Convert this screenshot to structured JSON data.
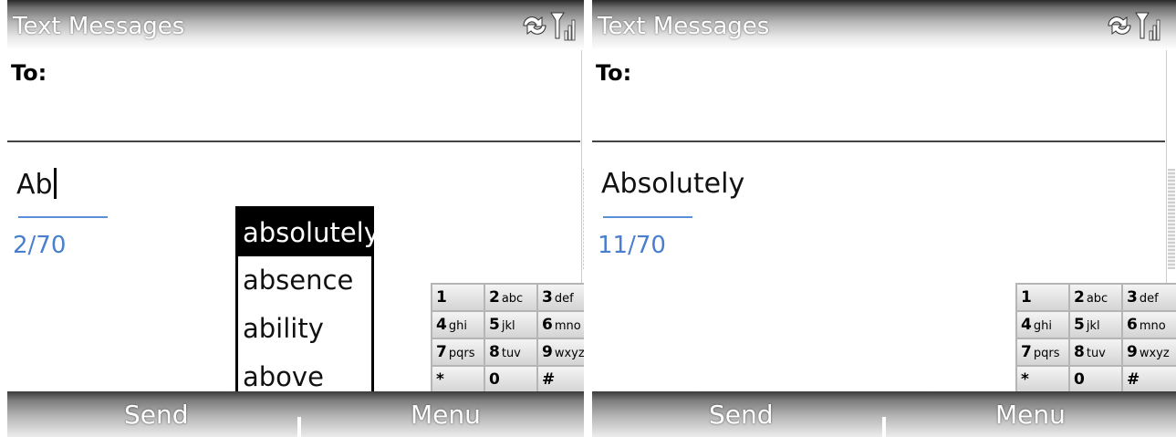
{
  "screens": [
    {
      "title": "Text Messages",
      "to_label": "To:",
      "body_text": "Ab",
      "char_count": "2/70",
      "suggestions": [
        "absolutely",
        "absence",
        "ability",
        "above"
      ],
      "selected_suggestion": "absolutely",
      "left_soft_key": "Send",
      "right_soft_key": "Menu"
    },
    {
      "title": "Text Messages",
      "to_label": "To:",
      "body_text": "Absolutely",
      "char_count": "11/70",
      "left_soft_key": "Send",
      "right_soft_key": "Menu"
    }
  ],
  "keypad": [
    {
      "digit": "1",
      "letters": ""
    },
    {
      "digit": "2",
      "letters": "abc"
    },
    {
      "digit": "3",
      "letters": "def"
    },
    {
      "digit": "4",
      "letters": "ghi"
    },
    {
      "digit": "5",
      "letters": "jkl"
    },
    {
      "digit": "6",
      "letters": "mno"
    },
    {
      "digit": "7",
      "letters": "pqrs"
    },
    {
      "digit": "8",
      "letters": "tuv"
    },
    {
      "digit": "9",
      "letters": "wxyz"
    },
    {
      "digit": "*",
      "letters": ""
    },
    {
      "digit": "0",
      "letters": ""
    },
    {
      "digit": "#",
      "letters": ""
    }
  ],
  "icons": [
    "connectivity-icon",
    "signal-strength-icon"
  ],
  "colors": {
    "counter": "#4a7fcf",
    "underline": "#5b8fd8",
    "selected_bg": "#000000"
  }
}
